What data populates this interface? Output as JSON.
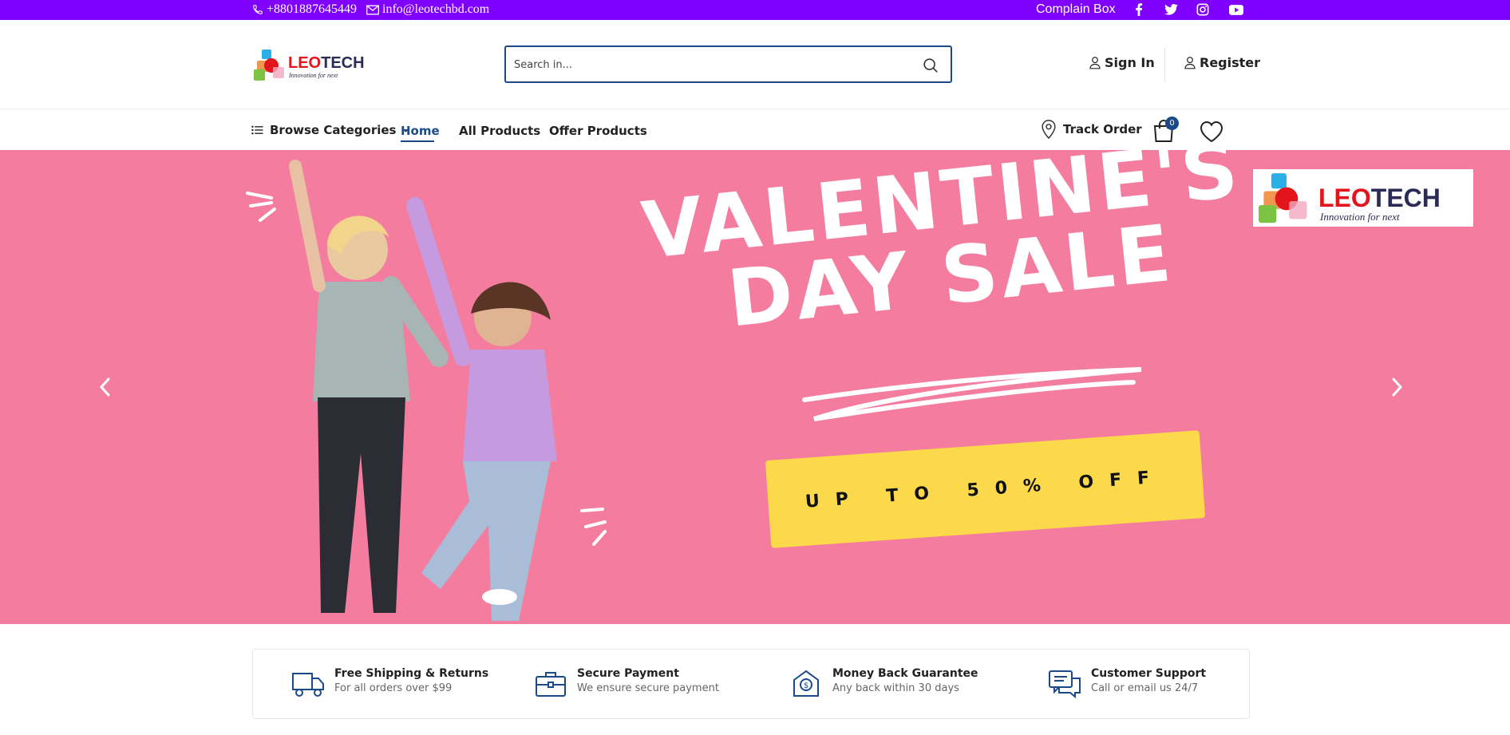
{
  "topbar": {
    "phone": "+8801887645449",
    "email": "info@leotechbd.com",
    "complain": "Complain Box",
    "socials": [
      "facebook-icon",
      "twitter-icon",
      "instagram-icon",
      "youtube-icon"
    ]
  },
  "header": {
    "logo_leo": "LEO",
    "logo_tech": "TECH",
    "logo_tagline": "Innovation for next",
    "search_placeholder": "Search in...",
    "sign_in": "Sign In",
    "register": "Register"
  },
  "nav": {
    "browse": "Browse Categories",
    "links": [
      "Home",
      "All Products",
      "Offer Products"
    ],
    "track_order": "Track Order",
    "cart_count": "0"
  },
  "hero": {
    "title_line1": "VALENTINE'S",
    "title_line2": "DAY SALE",
    "offer": "UP TO 50% OFF",
    "logo_leo": "LEO",
    "logo_tech": "TECH",
    "logo_tagline": "Innovation for next"
  },
  "features": [
    {
      "title": "Free Shipping & Returns",
      "subtitle": "For all orders over $99",
      "icon": "truck-icon"
    },
    {
      "title": "Secure Payment",
      "subtitle": "We ensure secure payment",
      "icon": "briefcase-icon"
    },
    {
      "title": "Money Back Guarantee",
      "subtitle": "Any back within 30 days",
      "icon": "money-back-icon"
    },
    {
      "title": "Customer Support",
      "subtitle": "Call or email us 24/7",
      "icon": "chat-icon"
    }
  ],
  "colors": {
    "topbar": "#8000ff",
    "accent": "#1a4a8a",
    "hero_bg": "#f47c9f",
    "offer_bg": "#fcd94a"
  }
}
